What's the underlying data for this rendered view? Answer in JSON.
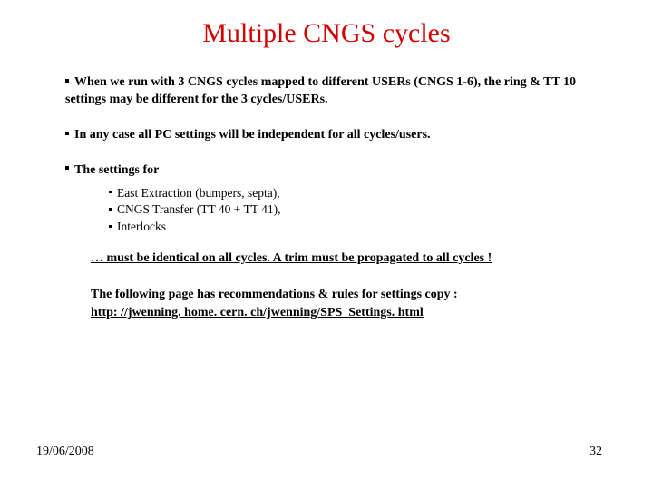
{
  "title": "Multiple CNGS cycles",
  "bullets": {
    "b1": "When we run with 3 CNGS cycles mapped to different USERs (CNGS 1-6), the ring & TT 10 settings may be different for the 3 cycles/USERs.",
    "b2": "In any case all PC settings will be independent for all cycles/users.",
    "b3": "The settings for",
    "sub1": "East Extraction (bumpers, septa),",
    "sub2": "CNGS Transfer (TT 40 + TT 41),",
    "sub3": "Interlocks",
    "warn": "… must be identical on all cycles. A trim must be propagated to all cycles !",
    "reco": "The following page has recommendations & rules for settings copy :",
    "link": "http: //jwenning. home. cern. ch/jwenning/SPS_Settings. html"
  },
  "footer": {
    "date": "19/06/2008",
    "page": "32"
  }
}
